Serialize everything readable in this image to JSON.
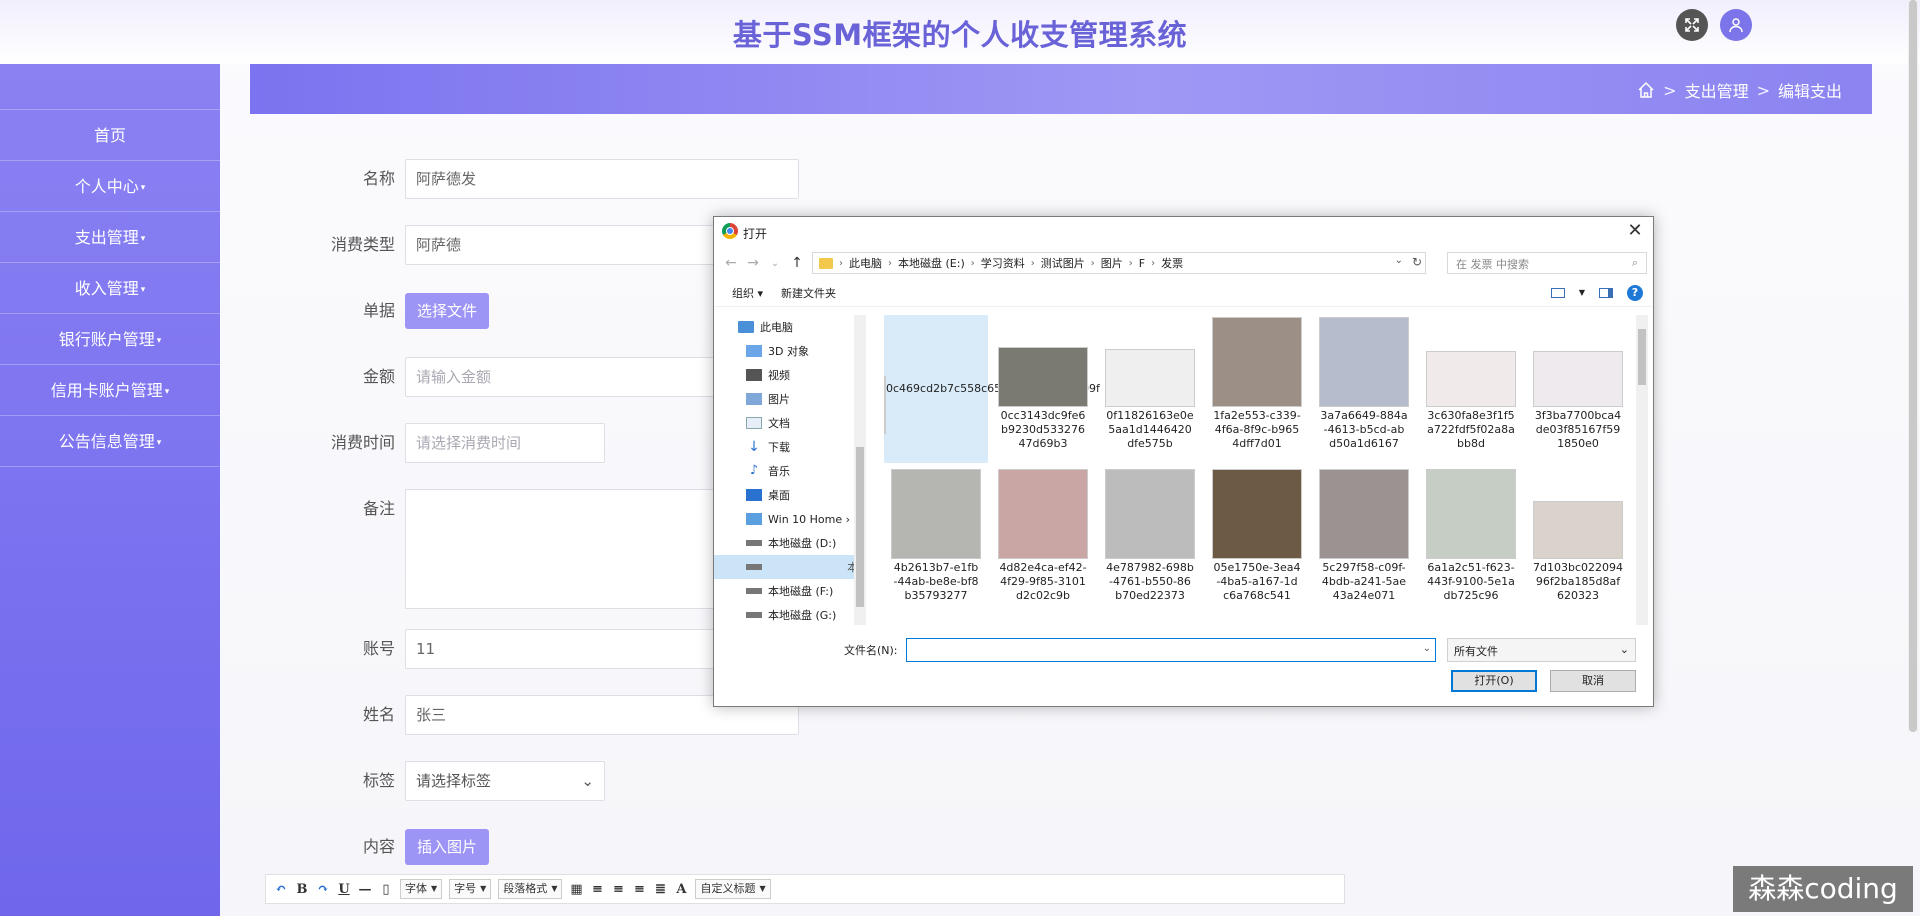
{
  "header": {
    "title": "基于SSM框架的个人收支管理系统"
  },
  "sidebar": {
    "items": [
      {
        "label": "首页"
      },
      {
        "label": "个人中心",
        "caret": "▾"
      },
      {
        "label": "支出管理",
        "caret": "▾"
      },
      {
        "label": "收入管理",
        "caret": "▾"
      },
      {
        "label": "银行账户管理",
        "caret": "▾"
      },
      {
        "label": "信用卡账户管理",
        "caret": "▾"
      },
      {
        "label": "公告信息管理",
        "caret": "▾"
      }
    ]
  },
  "breadcrumb": {
    "sep": ">",
    "level1": "支出管理",
    "level2": "编辑支出"
  },
  "form": {
    "name": {
      "label": "名称",
      "value": "阿萨德发"
    },
    "type": {
      "label": "消费类型",
      "value": "阿萨德"
    },
    "receipt": {
      "label": "单据",
      "button": "选择文件"
    },
    "amount": {
      "label": "金额",
      "placeholder": "请输入金额"
    },
    "time": {
      "label": "消费时间",
      "placeholder": "请选择消费时间"
    },
    "remark": {
      "label": "备注"
    },
    "account": {
      "label": "账号",
      "value": "11"
    },
    "person": {
      "label": "姓名",
      "value": "张三"
    },
    "tag": {
      "label": "标签",
      "placeholder": "请选择标签"
    },
    "content": {
      "label": "内容",
      "button": "插入图片"
    }
  },
  "editor": {
    "font": "字体",
    "size": "字号",
    "paragraph": "段落格式",
    "custom": "自定义标题"
  },
  "dialog": {
    "title": "打开",
    "path": [
      "此电脑",
      "本地磁盘 (E:)",
      "学习资料",
      "测试图片",
      "图片",
      "F",
      "发票"
    ],
    "search_placeholder": "在 发票 中搜索",
    "organize": "组织 ▾",
    "new_folder": "新建文件夹",
    "help": "?",
    "nav": [
      {
        "label": "此电脑",
        "icon": "pc"
      },
      {
        "label": "3D 对象",
        "icon": "cube"
      },
      {
        "label": "视频",
        "icon": "video"
      },
      {
        "label": "图片",
        "icon": "pic"
      },
      {
        "label": "文档",
        "icon": "doc"
      },
      {
        "label": "下载",
        "icon": "down"
      },
      {
        "label": "音乐",
        "icon": "music"
      },
      {
        "label": "桌面",
        "icon": "desk"
      },
      {
        "label": "Win 10 Home ›",
        "icon": "win"
      },
      {
        "label": "本地磁盘 (D:)",
        "icon": "disk"
      },
      {
        "label": "本地磁盘 (E:)",
        "icon": "disk",
        "selected": true
      },
      {
        "label": "本地磁盘 (F:)",
        "icon": "disk"
      },
      {
        "label": "本地磁盘 (G:)",
        "icon": "disk"
      }
    ],
    "files": [
      {
        "line1": "0c469cd2b7c55",
        "line2": "8c6546d6bd03f",
        "line3": "d7209f",
        "selected": true
      },
      {
        "line1": "0cc3143dc9fe6",
        "line2": "b9230d533276",
        "line3": "47d69b3"
      },
      {
        "line1": "0f11826163e0e",
        "line2": "5aa1d1446420",
        "line3": "dfe575b"
      },
      {
        "line1": "1fa2e553-c339-",
        "line2": "4f6a-8f9c-b965",
        "line3": "4dff7d01"
      },
      {
        "line1": "3a7a6649-884a",
        "line2": "-4613-b5cd-ab",
        "line3": "d50a1d6167"
      },
      {
        "line1": "3c630fa8e3f1f5",
        "line2": "a722fdf5f02a8a",
        "line3": "bb8d"
      },
      {
        "line1": "3f3ba7700bca4",
        "line2": "de03f85167f59",
        "line3": "1850e0"
      },
      {
        "line1": "4b2613b7-e1fb",
        "line2": "-44ab-be8e-bf8",
        "line3": "b35793277"
      },
      {
        "line1": "4d82e4ca-ef42-",
        "line2": "4f29-9f85-3101",
        "line3": "d2c02c9b"
      },
      {
        "line1": "4e787982-698b",
        "line2": "-4761-b550-86",
        "line3": "b70ed22373"
      },
      {
        "line1": "05e1750e-3ea4",
        "line2": "-4ba5-a167-1d",
        "line3": "c6a768c541"
      },
      {
        "line1": "5c297f58-c09f-",
        "line2": "4bdb-a241-5ae",
        "line3": "43a24e071"
      },
      {
        "line1": "6a1a2c51-f623-",
        "line2": "443f-9100-5e1a",
        "line3": "db725c96"
      },
      {
        "line1": "7d103bc022094",
        "line2": "96f2ba185d8af",
        "line3": "620323"
      }
    ],
    "filename_label": "文件名(N):",
    "filetype": "所有文件",
    "open_btn": "打开(O)",
    "cancel_btn": "取消"
  },
  "watermark": "森森coding"
}
